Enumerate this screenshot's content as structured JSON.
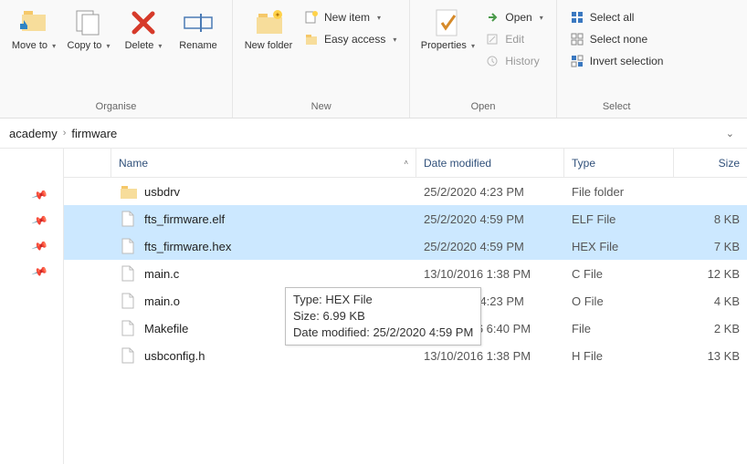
{
  "ribbon": {
    "move_to": "Move to",
    "copy_to": "Copy to",
    "delete": "Delete",
    "rename": "Rename",
    "new_folder": "New folder",
    "new_item": "New item",
    "easy_access": "Easy access",
    "properties": "Properties",
    "open": "Open",
    "edit": "Edit",
    "history": "History",
    "select_all": "Select all",
    "select_none": "Select none",
    "invert_selection": "Invert selection",
    "groups": {
      "organise": "Organise",
      "new": "New",
      "open": "Open",
      "select": "Select"
    }
  },
  "breadcrumb": {
    "parent": "academy",
    "current": "firmware"
  },
  "columns": {
    "name": "Name",
    "date": "Date modified",
    "type": "Type",
    "size": "Size"
  },
  "files": [
    {
      "name": "usbdrv",
      "icon": "folder",
      "date": "25/2/2020 4:23 PM",
      "type": "File folder",
      "size": "",
      "selected": false
    },
    {
      "name": "fts_firmware.elf",
      "icon": "file",
      "date": "25/2/2020 4:59 PM",
      "type": "ELF File",
      "size": "8 KB",
      "selected": true
    },
    {
      "name": "fts_firmware.hex",
      "icon": "file",
      "date": "25/2/2020 4:59 PM",
      "type": "HEX File",
      "size": "7 KB",
      "selected": true
    },
    {
      "name": "main.c",
      "icon": "file",
      "date": "13/10/2016 1:38 PM",
      "type": "C File",
      "size": "12 KB",
      "selected": false
    },
    {
      "name": "main.o",
      "icon": "file",
      "date": "25/2/2020 4:23 PM",
      "type": "O File",
      "size": "4 KB",
      "selected": false
    },
    {
      "name": "Makefile",
      "icon": "file",
      "date": "13/10/2016 6:40 PM",
      "type": "File",
      "size": "2 KB",
      "selected": false
    },
    {
      "name": "usbconfig.h",
      "icon": "file",
      "date": "13/10/2016 1:38 PM",
      "type": "H File",
      "size": "13 KB",
      "selected": false
    }
  ],
  "tooltip": {
    "type_label": "Type: ",
    "type_value": "HEX File",
    "size_label": "Size: ",
    "size_value": "6.99 KB",
    "date_label": "Date modified: ",
    "date_value": "25/2/2020 4:59 PM"
  }
}
